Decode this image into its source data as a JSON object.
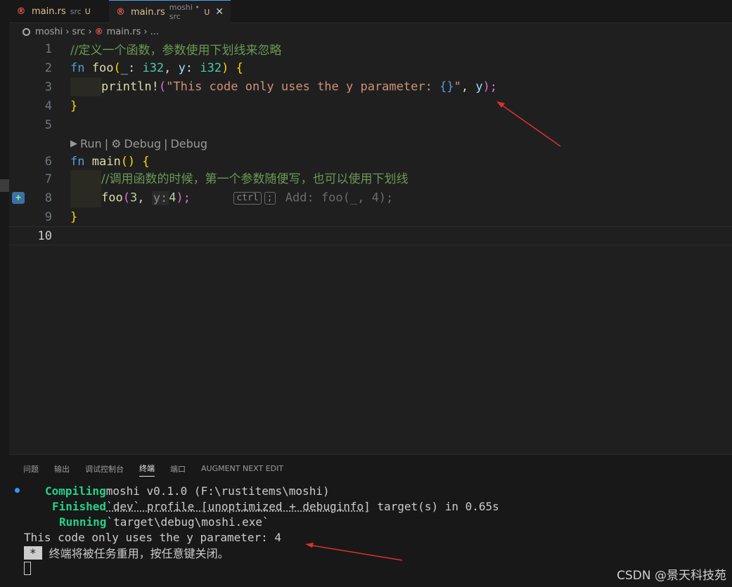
{
  "tabs": [
    {
      "icon": "rust-file-icon",
      "name": "main.rs",
      "desc": "src",
      "badge": "U"
    },
    {
      "icon": "rust-file-icon",
      "name": "main.rs",
      "desc": "moshi • src",
      "badge": "U",
      "close": "✕"
    }
  ],
  "breadcrumb": {
    "root": "moshi",
    "folder": "src",
    "file": "main.rs",
    "more": "..."
  },
  "editor": {
    "ln": [
      "1",
      "2",
      "3",
      "4",
      "5",
      "6",
      "7",
      "8",
      "9",
      "10"
    ],
    "line1_comment": "//定义一个函数，参数使用下划线来忽略",
    "line2": {
      "kw": "fn",
      "fn": "foo",
      "p1": "_",
      "colon1": ":",
      "t1": "i32",
      "comma": ",",
      "p2": "y",
      "colon2": ":",
      "t2": "i32",
      "open": "{"
    },
    "line3": {
      "macro": "println!",
      "str1": "\"This code only uses the y parameter: ",
      "fmt": "{}",
      "str2": "\"",
      "comma": ",",
      "arg": "y",
      "end": ");"
    },
    "line4_close": "}",
    "codelens": {
      "run": "Run",
      "sep1": "|",
      "debug1": "Debug",
      "sep2": "|",
      "debug2": "Debug"
    },
    "line6": {
      "kw": "fn",
      "fn": "main",
      "rest": "()",
      "open": "{"
    },
    "line7_comment": "//调用函数的时候，第一个参数随便写，也可以使用下划线",
    "line8": {
      "fn": "foo",
      "open": "(",
      "n1": "3",
      "comma": ",",
      "hint": "y:",
      "n2": "4",
      "end": ");",
      "kbd1": "ctrl",
      "kbd2": ";",
      "ghost": "Add: foo(_, 4);"
    },
    "line9_close": "}"
  },
  "panel": {
    "tabs": [
      "问题",
      "输出",
      "调试控制台",
      "终端",
      "端口",
      "AUGMENT NEXT EDIT"
    ],
    "active_tab": "终端"
  },
  "terminal": {
    "l1_label": "Compiling",
    "l1_text": "moshi v0.1.0 (F:\\rustitems\\moshi)",
    "l2_label": "Finished",
    "l2_a": "`dev` profile [unoptimized + debuginfo]",
    "l2_b": " target(s) in 0.65s",
    "l3_label": "Running",
    "l3_text": "`target\\debug\\moshi.exe`",
    "l4": "This code only uses the y parameter: 4",
    "l5_star": "*",
    "l5_text": "终端将被任务重用，按任意键关闭。"
  },
  "watermark": "CSDN @景天科技苑",
  "colors": {
    "accent": "#4c9df3",
    "comment": "#6a9955",
    "keyword": "#569cd6",
    "function": "#dcdcaa",
    "string": "#ce9178",
    "terminal_green": "#23d18b",
    "arrow": "#e03030"
  }
}
